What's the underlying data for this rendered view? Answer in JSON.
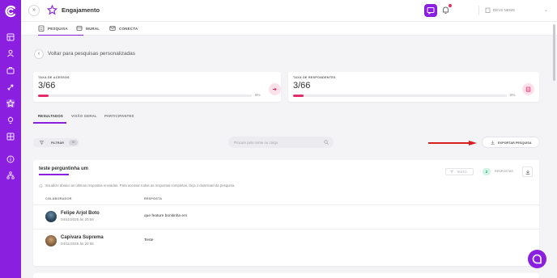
{
  "app": {
    "title": "Engajamento",
    "org_name": "DEVS NEWS",
    "brand_color": "#8b1fe0"
  },
  "top_tabs": [
    {
      "label": "PESQUISA",
      "icon": "clipboard-icon",
      "active": true
    },
    {
      "label": "MURAL",
      "icon": "megaphone-icon",
      "active": false
    },
    {
      "label": "CONECTA",
      "icon": "mail-icon",
      "active": false
    }
  ],
  "back": {
    "label": "Voltar para pesquisas personalizadas"
  },
  "stats": [
    {
      "label": "TAXA DE ACESSOS",
      "value": "3/66",
      "percent_text": "5%",
      "progress": 0.05
    },
    {
      "label": "TAXA DE RESPONDENTES",
      "value": "3/66",
      "percent_text": "5%",
      "progress": 0.05
    }
  ],
  "sub_tabs": [
    {
      "label": "RESULTADOS",
      "active": true
    },
    {
      "label": "VISÃO GERAL",
      "active": false
    },
    {
      "label": "PARTICIPANTES",
      "active": false
    }
  ],
  "filter": {
    "label": "FILTRAR",
    "count": "0"
  },
  "search": {
    "placeholder": "Procure pelo nome ou cargo"
  },
  "export": {
    "label": "EXPORTAR PESQUISA"
  },
  "question": {
    "title": "teste perguntinha um",
    "type_label": "TEXTO",
    "response_count": "2",
    "response_label": "RESPOSTAS",
    "info": "Visualize abaixo as últimas respostas enviadas. Para acessar todas as respostas completas, faça o download da pesquisa.",
    "columns": [
      "COLABORADOR",
      "RESPOSTA"
    ],
    "rows": [
      {
        "name": "Felipe Arjol Boto",
        "date": "04/11/2025 às 20:59",
        "answer": "que feature bonitinha em"
      },
      {
        "name": "Capivara Suprema",
        "date": "04/11/2025 às 20:56",
        "answer": "Teste"
      }
    ]
  }
}
